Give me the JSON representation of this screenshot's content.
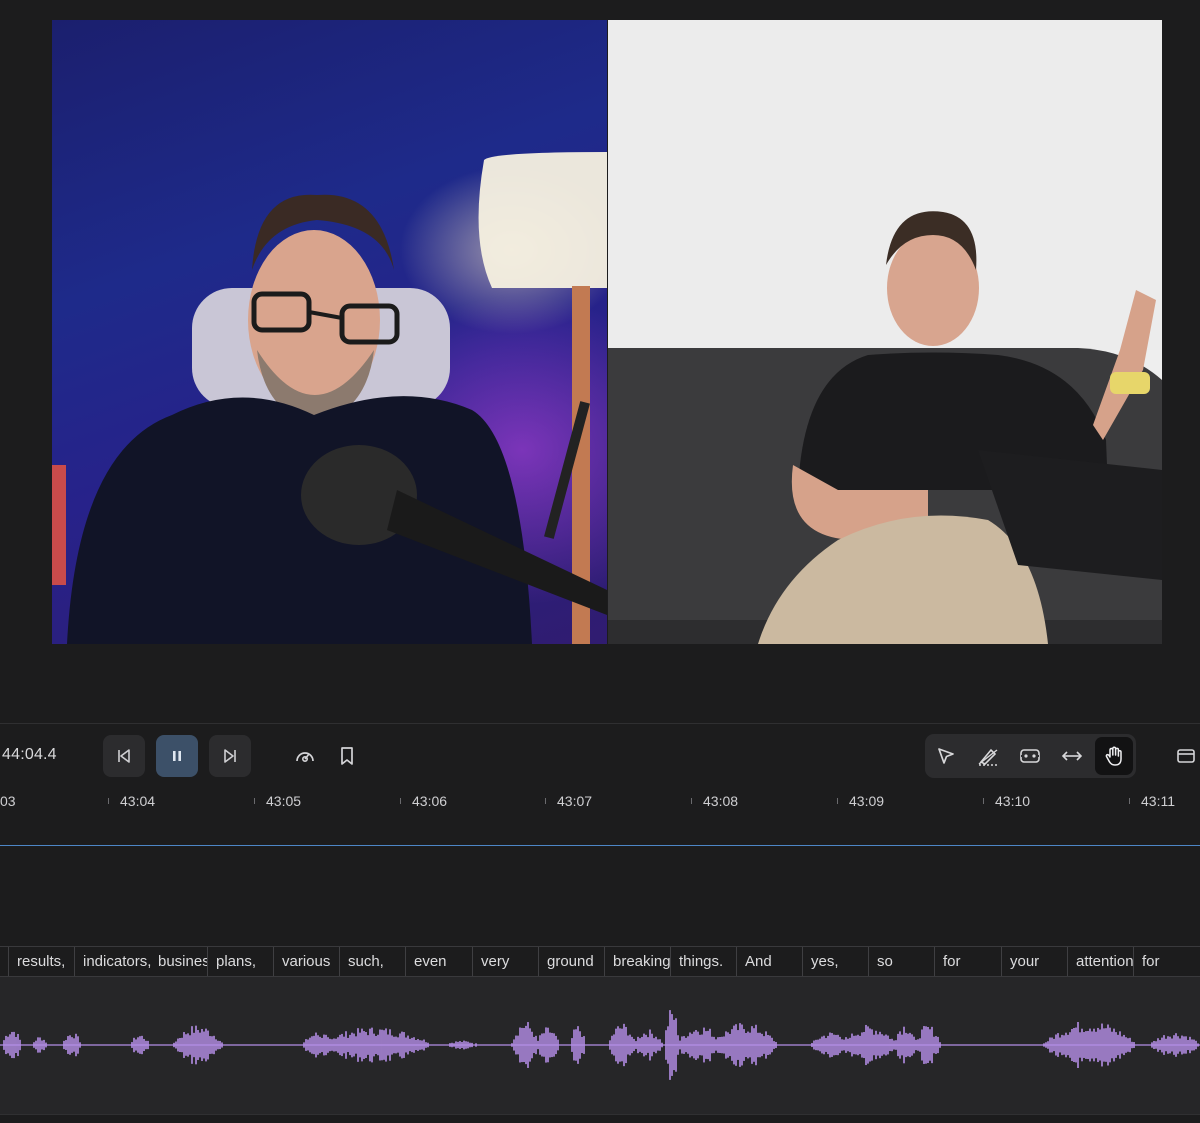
{
  "player": {
    "timecode": "44:04.4"
  },
  "transport": {
    "prev_icon": "skip-back-icon",
    "pause_icon": "pause-icon",
    "next_icon": "skip-forward-icon",
    "speed_icon": "speed-gauge-icon",
    "bookmark_icon": "bookmark-icon"
  },
  "tools": [
    "select-arrow-icon",
    "trim-pen-icon",
    "clip-range-icon",
    "stretch-arrows-icon",
    "hand-pan-icon"
  ],
  "ruler": {
    "ticks": [
      "03",
      "43:04",
      "43:05",
      "43:06",
      "43:07",
      "43:08",
      "43:09",
      "43:10",
      "43:11"
    ]
  },
  "transcript": {
    "words": [
      "results,",
      "indicators,",
      "business",
      "plans,",
      "various",
      "such,",
      "even",
      "very",
      "ground",
      "breaking",
      "things.",
      "And",
      "yes,",
      "so",
      "for",
      "your",
      "attention",
      "for"
    ]
  },
  "colors": {
    "accent_blue": "#4d86c6",
    "waveform_purple": "#b48ee6",
    "active_button": "#3c5068"
  }
}
